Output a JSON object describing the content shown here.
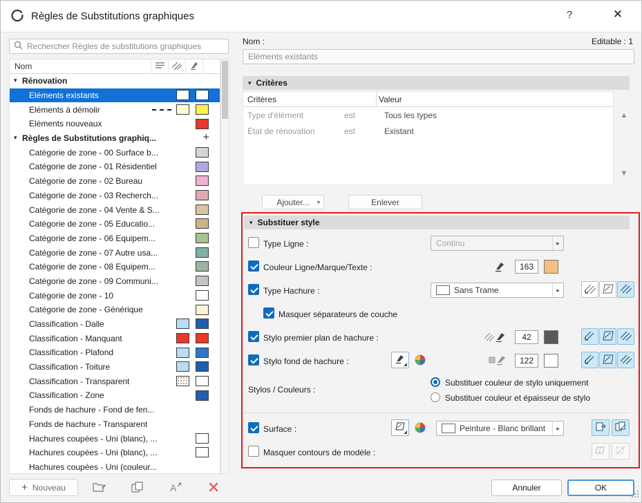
{
  "window": {
    "title": "Règles de Substitutions graphiques",
    "help_glyph": "?",
    "close_glyph": "✕"
  },
  "icons": {
    "dropdown": "▸",
    "group_triangle": "▾",
    "section_triangle": "▾",
    "up_arrow": "▲",
    "down_arrow": "▼",
    "plus": "+"
  },
  "colors": {
    "selection_blue": "#1271d6",
    "accent_blue": "#0f6cbd",
    "red_outline": "#e31b1b",
    "active_button_bg": "#cde8f6"
  },
  "search": {
    "placeholder": "Rechercher Règles de substitutions graphiques"
  },
  "list": {
    "name_column": "Nom",
    "items": [
      {
        "label": "Rénovation",
        "type": "group"
      },
      {
        "label": "Eléments existants",
        "type": "item",
        "selected": true,
        "sw1": "#ffffff",
        "sw2": "#ffffff"
      },
      {
        "label": "Eléments à démolir",
        "type": "item",
        "dashed": true,
        "sw1": "#fffbd6",
        "sw2": "#fdf24b"
      },
      {
        "label": "Eléments nouveaux",
        "type": "item",
        "sw2": "#e8392b"
      },
      {
        "label": "Règles de Substitutions graphiq...",
        "type": "group",
        "plus": true
      },
      {
        "label": "Catégorie de zone - 00 Surface b...",
        "sw2": "#d6d6d6"
      },
      {
        "label": "Catégorie de zone - 01 Résidentiel",
        "sw2": "#b3a8e4"
      },
      {
        "label": "Catégorie de zone - 02 Bureau",
        "sw2": "#f3b0d4"
      },
      {
        "label": "Catégorie de zone - 03 Recherch...",
        "sw2": "#e2a9b3"
      },
      {
        "label": "Catégorie de zone - 04 Vente & S...",
        "sw2": "#d9c5a0"
      },
      {
        "label": "Catégorie de zone - 05 Educatio...",
        "sw2": "#cab681"
      },
      {
        "label": "Catégorie de zone - 06 Equipem...",
        "sw2": "#a9c291"
      },
      {
        "label": "Catégorie de zone - 07 Autre usa...",
        "sw2": "#7fb0a0"
      },
      {
        "label": "Catégorie de zone - 08 Equipem...",
        "sw2": "#9eb3a2"
      },
      {
        "label": "Catégorie de zone - 09 Communi...",
        "sw2": "#c4c4c4"
      },
      {
        "label": "Catégorie de zone - 10",
        "sw2": "#ffffff"
      },
      {
        "label": "Catégorie de zone - Générique",
        "sw2": "#fbf3d2"
      },
      {
        "label": "Classification - Dalle",
        "sw1": "#badcf5",
        "sw2": "#1f60ab"
      },
      {
        "label": "Classification - Manquant",
        "sw1": "#e8392b",
        "sw2": "#e8392b"
      },
      {
        "label": "Classification - Plafond",
        "sw1": "#badcf5",
        "sw2": "#2f76c8"
      },
      {
        "label": "Classification - Toiture",
        "sw1": "#badcf5",
        "sw2": "#1f60ab"
      },
      {
        "label": "Classification - Transparent",
        "sw1": "dotted",
        "sw2": "#ffffff"
      },
      {
        "label": "Classification - Zone",
        "sw2": "#1f60ab"
      },
      {
        "label": "Fonds de hachure - Fond de fen..."
      },
      {
        "label": "Fonds de hachure - Transparent"
      },
      {
        "label": "Hachures coupées - Uni (blanc), ...",
        "sw2": "#ffffff"
      },
      {
        "label": "Hachures coupées - Uni (blanc), ...",
        "sw2": "#ffffff"
      },
      {
        "label": "Hachures coupées - Uni (couleur..."
      }
    ]
  },
  "footer": {
    "new_label": "Nouveau"
  },
  "detail": {
    "name_label": "Nom :",
    "editable_label": "Editable : 1",
    "name_value": "Eléments existants"
  },
  "criteria": {
    "header": "Critères",
    "col_criteria": "Critères",
    "col_value": "Valeur",
    "rows": [
      {
        "name": "Type d'élément",
        "op": "est",
        "value": "Tous les types"
      },
      {
        "name": "État de rénovation",
        "op": "est",
        "value": "Existant"
      }
    ],
    "add_button": "Ajouter...",
    "remove_button": "Enlever"
  },
  "substitute": {
    "header": "Substituer style",
    "type_ligne": {
      "label": "Type Ligne :",
      "checked": false,
      "value": "Continu"
    },
    "couleur_ligne": {
      "label": "Couleur Ligne/Marque/Texte :",
      "checked": true,
      "pen_number": "163",
      "color": "#f6bf7d"
    },
    "type_hachure": {
      "label": "Type Hachure :",
      "checked": true,
      "value": "Sans Trame"
    },
    "masquer_separateurs": {
      "label": "Masquer séparateurs de couche",
      "checked": true
    },
    "stylo_premier": {
      "label": "Stylo premier plan de hachure :",
      "checked": true,
      "pen_number": "42",
      "color": "#595959"
    },
    "stylo_fond": {
      "label": "Stylo fond de hachure :",
      "checked": true,
      "pen_number": "122",
      "color": "#ffffff"
    },
    "stylos_couleurs": {
      "label": "Stylos / Couleurs :",
      "options": [
        "Substituer couleur de stylo uniquement",
        "Substituer couleur et épaisseur de stylo"
      ],
      "selected": 0
    },
    "surface": {
      "label": "Surface :",
      "checked": true,
      "value": "Peinture - Blanc brillant"
    },
    "masquer_contours": {
      "label": "Masquer contours de modèle :",
      "checked": false
    }
  },
  "actions": {
    "cancel": "Annuler",
    "ok": "OK"
  }
}
